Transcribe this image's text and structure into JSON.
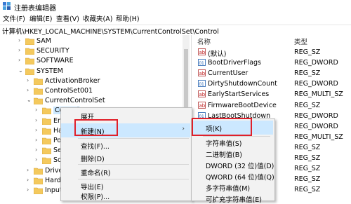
{
  "window": {
    "title": "注册表编辑器"
  },
  "menu": [
    "文件(F)",
    "编辑(E)",
    "查看(V)",
    "收藏夹(A)",
    "帮助(H)"
  ],
  "address": "计算机\\HKEY_LOCAL_MACHINE\\SYSTEM\\CurrentControlSet\\Control",
  "tree": [
    {
      "label": "SAM",
      "expanded": false
    },
    {
      "label": "SECURITY",
      "expanded": false
    },
    {
      "label": "SOFTWARE",
      "expanded": false
    },
    {
      "label": "SYSTEM",
      "expanded": true
    },
    {
      "label": "ActivationBroker",
      "expanded": false
    },
    {
      "label": "ControlSet001",
      "expanded": false
    },
    {
      "label": "CurrentControlSet",
      "expanded": true
    },
    {
      "label": "Control",
      "expanded": false,
      "selected": true
    },
    {
      "label": "Enu",
      "expanded": false
    },
    {
      "label": "Ha",
      "expanded": false
    },
    {
      "label": "Po",
      "expanded": false
    },
    {
      "label": "Ser",
      "expanded": false
    },
    {
      "label": "Sof",
      "expanded": false
    },
    {
      "label": "Driver",
      "expanded": false
    },
    {
      "label": "Hardv",
      "expanded": false
    },
    {
      "label": "Input",
      "expanded": false
    }
  ],
  "values_panel": {
    "col_name": "名称",
    "col_type": "类型",
    "rows": [
      {
        "name": "(默认)",
        "type": "REG_SZ",
        "icon": "string-value-icon"
      },
      {
        "name": "BootDriverFlags",
        "type": "REG_DWORD",
        "icon": "binary-value-icon"
      },
      {
        "name": "CurrentUser",
        "type": "REG_SZ",
        "icon": "string-value-icon"
      },
      {
        "name": "DirtyShutdownCount",
        "type": "REG_DWORD",
        "icon": "binary-value-icon"
      },
      {
        "name": "EarlyStartServices",
        "type": "REG_MULTI_SZ",
        "icon": "string-value-icon"
      },
      {
        "name": "FirmwareBootDevice",
        "type": "REG_SZ",
        "icon": "string-value-icon"
      },
      {
        "name": "LastBootShutdown",
        "type": "REG_DWORD",
        "icon": "binary-value-icon"
      },
      {
        "name": "",
        "type": "REG_DWORD",
        "icon": ""
      },
      {
        "name": "",
        "type": "REG_MULTI_SZ",
        "icon": ""
      },
      {
        "name": "",
        "type": "REG_SZ",
        "icon": ""
      },
      {
        "name": "",
        "type": "REG_SZ",
        "icon": ""
      },
      {
        "name": "",
        "type": "REG_SZ",
        "icon": ""
      },
      {
        "name": "",
        "type": "REG_SZ",
        "icon": ""
      },
      {
        "name": "",
        "type": "REG_SZ",
        "icon": ""
      }
    ]
  },
  "context_menu": {
    "items": [
      "展开",
      "新建(N)",
      "查找(F)...",
      "删除(D)",
      "重命名(R)",
      "导出(E)",
      "权限(P)..."
    ]
  },
  "submenu": {
    "items": [
      "项(K)",
      "字符串值(S)",
      "二进制值(B)",
      "DWORD (32 位)值(D)",
      "QWORD (64 位)值(Q)",
      "多字符串值(M)",
      "可扩充字符串值(E)"
    ]
  },
  "colors": {
    "selection": "#cce8ff",
    "annotation": "#e0202a",
    "folder": "#f4c95d"
  }
}
